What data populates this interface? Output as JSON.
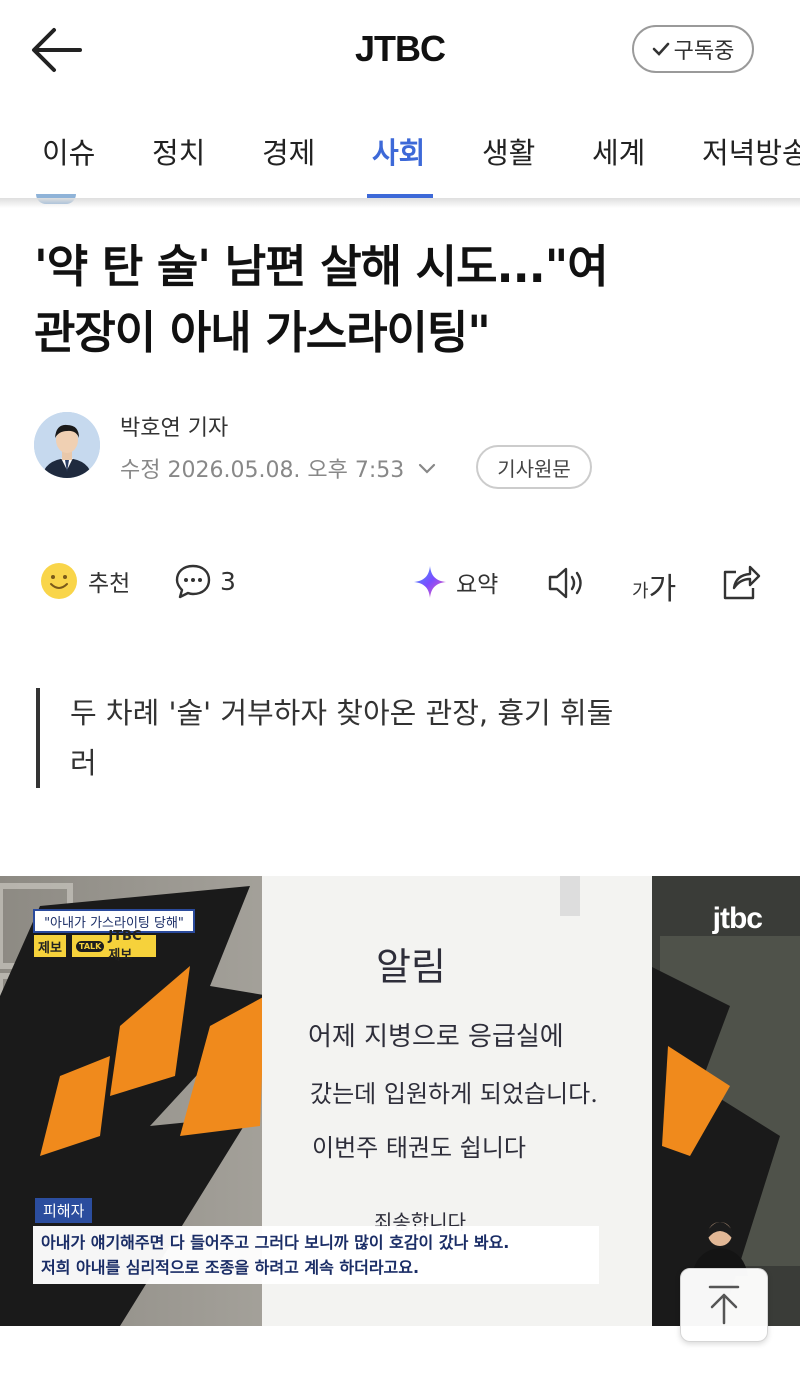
{
  "header": {
    "brand": "JTBC",
    "subscribe_label": "구독중"
  },
  "tabs": [
    {
      "label": "이슈"
    },
    {
      "label": "정치"
    },
    {
      "label": "경제"
    },
    {
      "label": "사회",
      "active": true
    },
    {
      "label": "생활"
    },
    {
      "label": "세계"
    },
    {
      "label": "저녁방송"
    }
  ],
  "article": {
    "title_line1": "'약 탄 술' 남편 살해 시도...\"여",
    "title_line2": "관장이 아내 가스라이팅\"",
    "reporter": "박호연 기자",
    "meta": "수정 2026.05.08. 오후 7:53",
    "original_button": "기사원문",
    "subhead_line1": "두 차례 '술' 거부하자 찾아온 관장, 흉기 휘둘",
    "subhead_line2": "러"
  },
  "actions": {
    "recommend_label": "추천",
    "comment_count": "3",
    "summary_label": "요약",
    "font_label_small": "가",
    "font_label_large": "가"
  },
  "photo": {
    "caption_top": "\"아내가 가스라이팅 당해\"",
    "tag_report": "제보",
    "tag_talk": "TALK",
    "tag_jtbc_report": "JTBC제보",
    "logo": "jtbc",
    "note_title": "알림",
    "note_line1": "어제 지병으로 응급실에",
    "note_line2": "갔는데 입원하게 되었습니다.",
    "note_line3": "이번주 태권도 쉽니다",
    "note_line4": "죄송합니다",
    "speaker_tag": "피해자",
    "subtitle_line1": "아내가 얘기해주면 다 들어주고 그러다 보니까 많이 호감이 갔나 봐요.",
    "subtitle_line2": "저희 아내를 심리적으로 조종을 하려고 계속 하더라고요."
  },
  "colors": {
    "accent": "#3d69d8",
    "caption_blue": "#2b4d9e",
    "tag_yellow": "#f6d23b"
  },
  "icons": [
    "back-arrow-icon",
    "check-icon",
    "chevron-down-icon",
    "smiley-icon",
    "comment-icon",
    "ai-sparkle-icon",
    "speaker-icon",
    "share-icon",
    "arrow-up-icon"
  ]
}
